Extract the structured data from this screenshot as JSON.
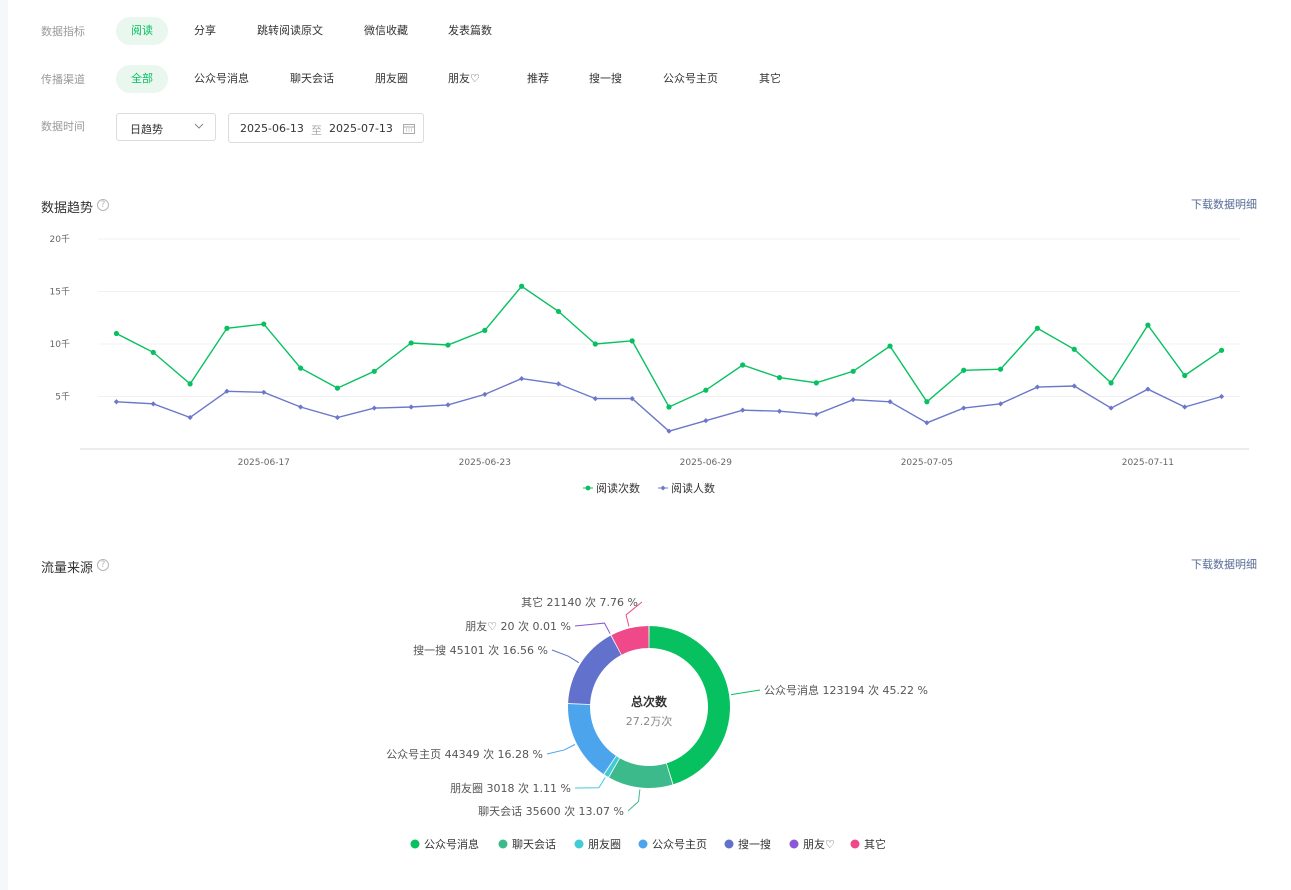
{
  "filters": {
    "metric": {
      "label": "数据指标",
      "options": [
        "阅读",
        "分享",
        "跳转阅读原文",
        "微信收藏",
        "发表篇数"
      ],
      "selected": "阅读"
    },
    "channel": {
      "label": "传播渠道",
      "options": [
        "全部",
        "公众号消息",
        "聊天会话",
        "朋友圈",
        "朋友♡",
        "推荐",
        "搜一搜",
        "公众号主页",
        "其它"
      ],
      "selected": "全部"
    },
    "time": {
      "label": "数据时间",
      "granularity": "日趋势",
      "start": "2025-06-13",
      "separator": "至",
      "end": "2025-07-13"
    }
  },
  "trend": {
    "title": "数据趋势",
    "download_label": "下载数据明细"
  },
  "source": {
    "title": "流量来源",
    "download_label": "下载数据明细",
    "center_title": "总次数",
    "center_value": "27.2万次"
  },
  "chart_data": [
    {
      "type": "line",
      "y_ticks": [
        "20千",
        "15千",
        "10千",
        "5千"
      ],
      "ylim": [
        0,
        20000
      ],
      "x_tick_labels": [
        "2025-06-17",
        "2025-06-23",
        "2025-06-29",
        "2025-07-05",
        "2025-07-11"
      ],
      "x": [
        "2025-06-13",
        "2025-06-14",
        "2025-06-15",
        "2025-06-16",
        "2025-06-17",
        "2025-06-18",
        "2025-06-19",
        "2025-06-20",
        "2025-06-21",
        "2025-06-22",
        "2025-06-23",
        "2025-06-24",
        "2025-06-25",
        "2025-06-26",
        "2025-06-27",
        "2025-06-28",
        "2025-06-29",
        "2025-06-30",
        "2025-07-01",
        "2025-07-02",
        "2025-07-03",
        "2025-07-04",
        "2025-07-05",
        "2025-07-06",
        "2025-07-07",
        "2025-07-08",
        "2025-07-09",
        "2025-07-10",
        "2025-07-11",
        "2025-07-12",
        "2025-07-13"
      ],
      "series": [
        {
          "name": "阅读次数",
          "color": "#07c160",
          "values": [
            11000,
            9200,
            6200,
            11500,
            11900,
            7700,
            5800,
            7400,
            10100,
            9900,
            11300,
            15500,
            13100,
            10000,
            10300,
            4000,
            5600,
            8000,
            6800,
            6300,
            7400,
            9800,
            4500,
            7500,
            7600,
            11500,
            9500,
            6300,
            11800,
            7000,
            9400
          ]
        },
        {
          "name": "阅读人数",
          "color": "#6b78c9",
          "values": [
            4500,
            4300,
            3000,
            5500,
            5400,
            4000,
            3000,
            3900,
            4000,
            4200,
            5200,
            6700,
            6200,
            4800,
            4800,
            1700,
            2700,
            3700,
            3600,
            3300,
            4700,
            4500,
            2500,
            3900,
            4300,
            5900,
            6000,
            3900,
            5700,
            4000,
            5000
          ]
        }
      ],
      "legend": "bottom"
    },
    {
      "type": "pie",
      "categories": [
        "公众号消息",
        "聊天会话",
        "朋友圈",
        "公众号主页",
        "搜一搜",
        "朋友♡",
        "其它"
      ],
      "values": [
        123194,
        35600,
        3018,
        44349,
        45101,
        20,
        21140
      ],
      "percents": [
        45.22,
        13.07,
        1.11,
        16.28,
        16.56,
        0.01,
        7.76
      ],
      "colors": [
        "#07c160",
        "#3cba8b",
        "#41cbd6",
        "#4ca4ec",
        "#6171cc",
        "#8b58d8",
        "#f0498a"
      ],
      "labels": [
        "公众号消息 123194 次 45.22 %",
        "聊天会话 35600 次 13.07 %",
        "朋友圈 3018 次 1.11 %",
        "公众号主页 44349 次 16.28 %",
        "搜一搜 45101 次 16.56 %",
        "朋友♡ 20 次 0.01 %",
        "其它 21140 次 7.76 %"
      ],
      "legend_labels": [
        "公众号消息",
        "聊天会话",
        "朋友圈",
        "公众号主页",
        "搜一搜",
        "朋友♡",
        "其它"
      ],
      "legend": "bottom"
    }
  ]
}
